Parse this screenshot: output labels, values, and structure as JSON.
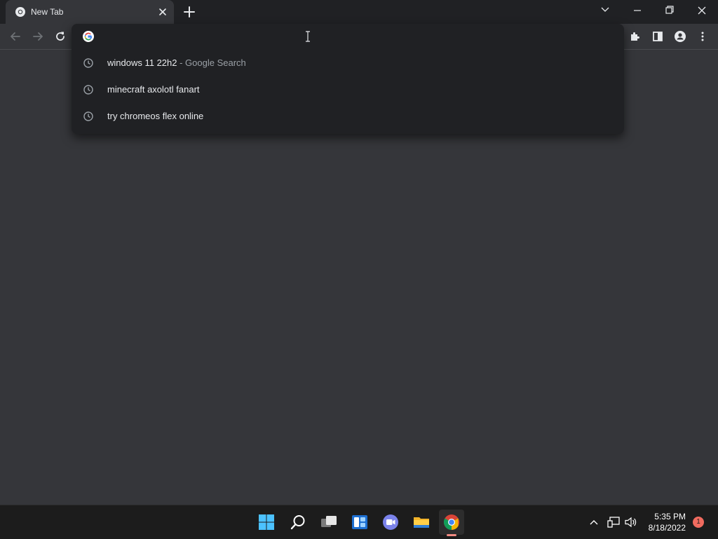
{
  "browser": {
    "tab": {
      "title": "New Tab"
    },
    "omnibox": {
      "value": "",
      "placeholder": "",
      "suggestions": [
        {
          "text": "windows 11 22h2",
          "sub": " - Google Search"
        },
        {
          "text": "minecraft axolotl fanart",
          "sub": ""
        },
        {
          "text": "try chromeos flex online",
          "sub": ""
        }
      ]
    }
  },
  "taskbar": {
    "time": "5:35 PM",
    "date": "8/18/2022",
    "notification_count": "1"
  },
  "colors": {
    "titlebar": "#202124",
    "page_bg": "#35363a",
    "dropdown_bg": "#202124",
    "taskbar_bg": "#1c1c1c"
  }
}
